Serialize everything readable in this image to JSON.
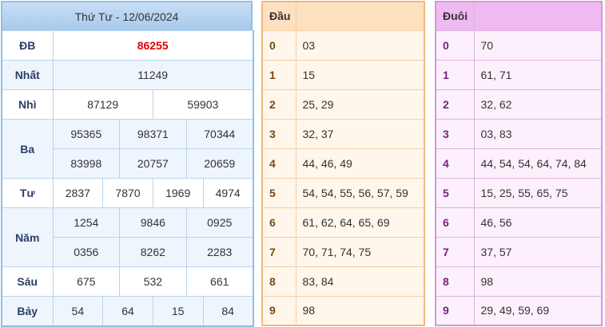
{
  "results": {
    "title": "Thứ Tư - 12/06/2024",
    "prizes": {
      "db": {
        "label": "ĐB",
        "values": [
          "86255"
        ]
      },
      "nhat": {
        "label": "Nhất",
        "values": [
          "11249"
        ]
      },
      "nhi": {
        "label": "Nhì",
        "values": [
          "87129",
          "59903"
        ]
      },
      "ba": {
        "label": "Ba",
        "values": [
          "95365",
          "98371",
          "70344",
          "83998",
          "20757",
          "20659"
        ]
      },
      "tu": {
        "label": "Tư",
        "values": [
          "2837",
          "7870",
          "1969",
          "4974"
        ]
      },
      "nam": {
        "label": "Năm",
        "values": [
          "1254",
          "9846",
          "0925",
          "0356",
          "8262",
          "2283"
        ]
      },
      "sau": {
        "label": "Sáu",
        "values": [
          "675",
          "532",
          "661"
        ]
      },
      "bay": {
        "label": "Bảy",
        "values": [
          "54",
          "64",
          "15",
          "84"
        ]
      }
    }
  },
  "heads": {
    "title": "Đầu",
    "rows": [
      {
        "key": "0",
        "value": "03"
      },
      {
        "key": "1",
        "value": "15"
      },
      {
        "key": "2",
        "value": "25, 29"
      },
      {
        "key": "3",
        "value": "32, 37"
      },
      {
        "key": "4",
        "value": "44, 46, 49"
      },
      {
        "key": "5",
        "value": "54, 54, 55, 56, 57, 59"
      },
      {
        "key": "6",
        "value": "61, 62, 64, 65, 69"
      },
      {
        "key": "7",
        "value": "70, 71, 74, 75"
      },
      {
        "key": "8",
        "value": "83, 84"
      },
      {
        "key": "9",
        "value": "98"
      }
    ]
  },
  "tails": {
    "title": "Đuôi",
    "rows": [
      {
        "key": "0",
        "value": "70"
      },
      {
        "key": "1",
        "value": "61, 71"
      },
      {
        "key": "2",
        "value": "32, 62"
      },
      {
        "key": "3",
        "value": "03, 83"
      },
      {
        "key": "4",
        "value": "44, 54, 54, 64, 74, 84"
      },
      {
        "key": "5",
        "value": "15, 25, 55, 65, 75"
      },
      {
        "key": "6",
        "value": "46, 56"
      },
      {
        "key": "7",
        "value": "37, 57"
      },
      {
        "key": "8",
        "value": "98"
      },
      {
        "key": "9",
        "value": "29, 49, 59, 69"
      }
    ]
  }
}
